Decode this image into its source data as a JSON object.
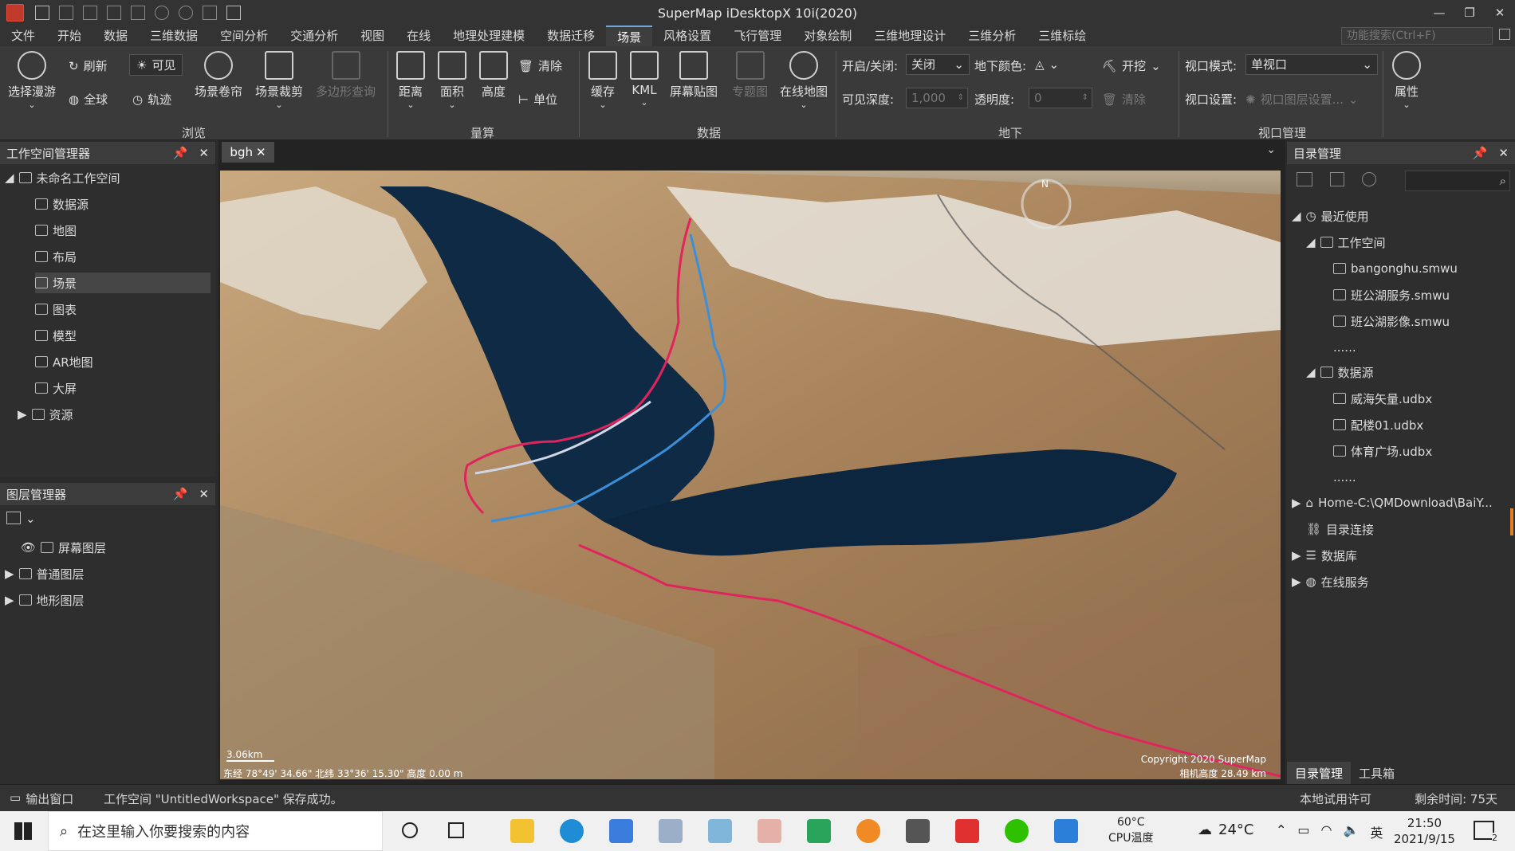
{
  "app": {
    "title": "SuperMap iDesktopX 10i(2020)"
  },
  "menu": {
    "items": [
      {
        "label": "文件"
      },
      {
        "label": "开始"
      },
      {
        "label": "数据"
      },
      {
        "label": "三维数据"
      },
      {
        "label": "空间分析"
      },
      {
        "label": "交通分析"
      },
      {
        "label": "视图"
      },
      {
        "label": "在线"
      },
      {
        "label": "地理处理建模"
      },
      {
        "label": "数据迁移"
      },
      {
        "label": "场景"
      },
      {
        "label": "风格设置"
      },
      {
        "label": "飞行管理"
      },
      {
        "label": "对象绘制"
      },
      {
        "label": "三维地理设计"
      },
      {
        "label": "三维分析"
      },
      {
        "label": "三维标绘"
      }
    ],
    "active_index": 10,
    "search_placeholder": "功能搜索(Ctrl+F)"
  },
  "ribbon": {
    "browse": {
      "group_label": "浏览",
      "select_roam": "选择漫游",
      "refresh": "刷新",
      "visible": "可见",
      "global": "全球",
      "track": "轨迹",
      "scene_curtain": "场景卷帘",
      "scene_clip": "场景裁剪",
      "polygon_query": "多边形查询"
    },
    "measure": {
      "group_label": "量算",
      "distance": "距离",
      "area": "面积",
      "height": "高度",
      "clear": "清除",
      "unit": "单位"
    },
    "data": {
      "group_label": "数据",
      "cache": "缓存",
      "kml": "KML",
      "screen_map": "屏幕贴图",
      "thematic": "专题图",
      "online_map": "在线地图"
    },
    "underground": {
      "group_label": "地下",
      "onoff_label": "开启/关闭:",
      "onoff_value": "关闭",
      "ground_color_label": "地下颜色:",
      "excavate": "开挖",
      "depth_label": "可见深度:",
      "depth_value": "1,000",
      "opacity_label": "透明度:",
      "opacity_value": "0",
      "clear": "清除"
    },
    "viewport": {
      "group_label": "视口管理",
      "mode_label": "视口模式:",
      "mode_value": "单视口",
      "settings_label": "视口设置:",
      "settings_value": "视口图层设置...",
      "properties": "属性"
    }
  },
  "workspace_panel": {
    "title": "工作空间管理器",
    "root": "未命名工作空间",
    "items": [
      "数据源",
      "地图",
      "布局",
      "场景",
      "图表",
      "模型",
      "AR地图",
      "大屏",
      "资源"
    ],
    "selected_index": 3
  },
  "layer_panel": {
    "title": "图层管理器",
    "items": [
      "屏幕图层",
      "普通图层",
      "地形图层"
    ]
  },
  "document": {
    "tab_label": "bgh"
  },
  "scene_overlay": {
    "scale": "3.06km",
    "coords": "东经 78°49' 34.66\"   北纬 33°36' 15.30\"   高度 0.00 m",
    "copyright": "Copyright 2020 SuperMap",
    "camera_height": "相机高度 28.49 km",
    "compass": "N"
  },
  "catalog_panel": {
    "title": "目录管理",
    "recent": "最近使用",
    "workspace_group": "工作空间",
    "workspaces": [
      "bangonghu.smwu",
      "班公湖服务.smwu",
      "班公湖影像.smwu",
      "......"
    ],
    "datasource_group": "数据源",
    "datasources": [
      "威海矢量.udbx",
      "配楼01.udbx",
      "体育广场.udbx",
      "......"
    ],
    "home": "Home-C:\\QMDownload\\BaiY...",
    "catalog_link": "目录连接",
    "database": "数据库",
    "online_service": "在线服务",
    "tabs": [
      "目录管理",
      "工具箱"
    ]
  },
  "status_bar": {
    "output_window": "输出窗口",
    "message": "工作空间 \"UntitledWorkspace\" 保存成功。",
    "license": "本地试用许可",
    "remaining": "剩余时间: 75天"
  },
  "taskbar": {
    "search_placeholder": "在这里输入你要搜索的内容",
    "cpu_temp": "60°C",
    "cpu_label": "CPU温度",
    "weather_temp": "24°C",
    "ime": "英",
    "time": "21:50",
    "date": "2021/9/15",
    "notifications": "2"
  }
}
